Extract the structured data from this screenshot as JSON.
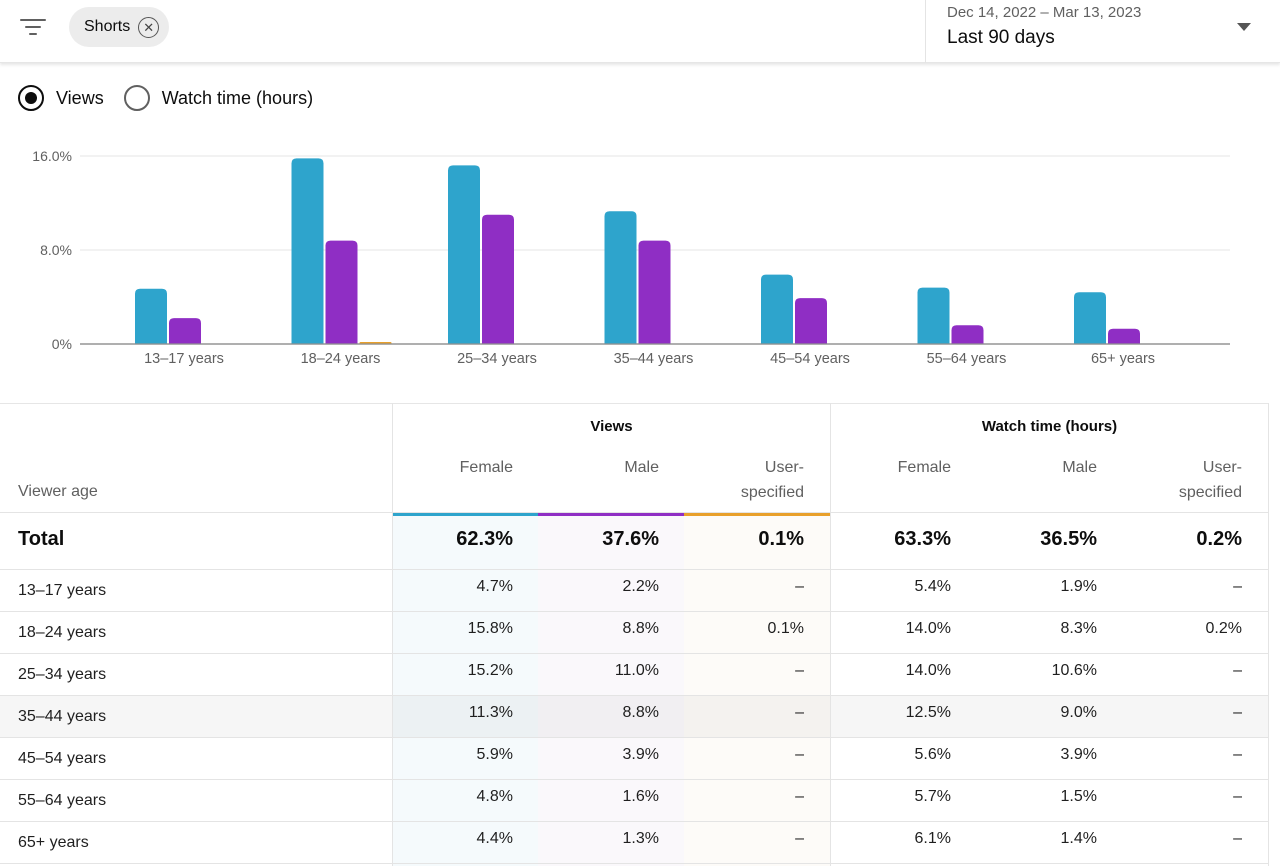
{
  "topbar": {
    "filter_icon": "filter-list-icon",
    "chip_label": "Shorts",
    "chip_close_icon": "close-circle-icon",
    "date_range": "Dec 14, 2022 – Mar 13, 2023",
    "date_label": "Last 90 days",
    "dropdown_icon": "dropdown-arrow-icon"
  },
  "metric_toggle": {
    "options": [
      {
        "label": "Views",
        "selected": true
      },
      {
        "label": "Watch time (hours)",
        "selected": false
      }
    ]
  },
  "colors": {
    "female": "#2ea4cc",
    "male": "#8f2ec4",
    "user_specified": "#e8a02c"
  },
  "chart_data": {
    "type": "bar",
    "title": "",
    "xlabel": "",
    "ylabel": "",
    "ylim": [
      0,
      16
    ],
    "yticks": [
      "0%",
      "8.0%",
      "16.0%"
    ],
    "ytick_values": [
      0,
      8,
      16
    ],
    "grid": true,
    "legend": "none",
    "categories": [
      "13–17 years",
      "18–24 years",
      "25–34 years",
      "35–44 years",
      "45–54 years",
      "55–64 years",
      "65+ years"
    ],
    "series": [
      {
        "name": "Female",
        "color": "#2ea4cc",
        "values": [
          4.7,
          15.8,
          15.2,
          11.3,
          5.9,
          4.8,
          4.4
        ]
      },
      {
        "name": "Male",
        "color": "#8f2ec4",
        "values": [
          2.2,
          8.8,
          11.0,
          8.8,
          3.9,
          1.6,
          1.3
        ]
      },
      {
        "name": "User-specified",
        "color": "#e8a02c",
        "values": [
          0,
          0.1,
          0,
          0,
          0,
          0,
          0
        ]
      }
    ]
  },
  "table": {
    "row_header_label": "Viewer age",
    "groups": [
      {
        "label": "Views",
        "columns": [
          "Female",
          "Male",
          "User-\nspecified"
        ]
      },
      {
        "label": "Watch time (hours)",
        "columns": [
          "Female",
          "Male",
          "User-\nspecified"
        ]
      }
    ],
    "total": {
      "label": "Total",
      "values": [
        "62.3%",
        "37.6%",
        "0.1%",
        "63.3%",
        "36.5%",
        "0.2%"
      ]
    },
    "rows": [
      {
        "label": "13–17 years",
        "values": [
          "4.7%",
          "2.2%",
          "–",
          "5.4%",
          "1.9%",
          "–"
        ]
      },
      {
        "label": "18–24 years",
        "values": [
          "15.8%",
          "8.8%",
          "0.1%",
          "14.0%",
          "8.3%",
          "0.2%"
        ]
      },
      {
        "label": "25–34 years",
        "values": [
          "15.2%",
          "11.0%",
          "–",
          "14.0%",
          "10.6%",
          "–"
        ]
      },
      {
        "label": "35–44 years",
        "values": [
          "11.3%",
          "8.8%",
          "–",
          "12.5%",
          "9.0%",
          "–"
        ]
      },
      {
        "label": "45–54 years",
        "values": [
          "5.9%",
          "3.9%",
          "–",
          "5.6%",
          "3.9%",
          "–"
        ]
      },
      {
        "label": "55–64 years",
        "values": [
          "4.8%",
          "1.6%",
          "–",
          "5.7%",
          "1.5%",
          "–"
        ]
      },
      {
        "label": "65+ years",
        "values": [
          "4.4%",
          "1.3%",
          "–",
          "6.1%",
          "1.4%",
          "–"
        ]
      }
    ]
  }
}
